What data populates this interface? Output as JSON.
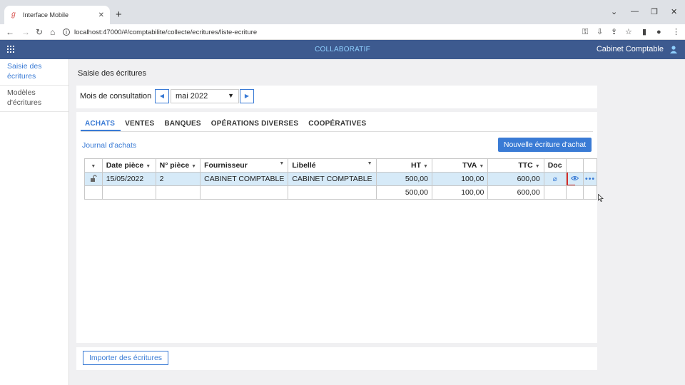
{
  "browser": {
    "tab_title": "Interface Mobile",
    "url": "localhost:47000/#/comptabilite/collecte/ecritures/liste-ecriture"
  },
  "app": {
    "title": "COLLABORATIF",
    "company": "Cabinet Comptable"
  },
  "sidebar": {
    "items": [
      {
        "label": "Saisie des écritures",
        "active": true
      },
      {
        "label": "Modèles d'écritures",
        "active": false
      }
    ]
  },
  "page": {
    "title": "Saisie des écritures"
  },
  "month": {
    "label": "Mois de consultation",
    "value": "mai 2022"
  },
  "tabs": [
    {
      "label": "ACHATS",
      "active": true
    },
    {
      "label": "VENTES",
      "active": false
    },
    {
      "label": "BANQUES",
      "active": false
    },
    {
      "label": "OPÉRATIONS DIVERSES",
      "active": false
    },
    {
      "label": "COOPÉRATIVES",
      "active": false
    }
  ],
  "journal": {
    "link": "Journal d'achats",
    "new_button": "Nouvelle écriture d'achat"
  },
  "table": {
    "headers": {
      "date": "Date pièce",
      "piece": "N° pièce",
      "fournisseur": "Fournisseur",
      "libelle": "Libellé",
      "ht": "HT",
      "tva": "TVA",
      "ttc": "TTC",
      "doc": "Doc"
    },
    "rows": [
      {
        "date": "15/05/2022",
        "piece": "2",
        "fournisseur": "CABINET COMPTABLE",
        "libelle": "CABINET COMPTABLE",
        "ht": "500,00",
        "tva": "100,00",
        "ttc": "600,00"
      }
    ],
    "totals": {
      "ht": "500,00",
      "tva": "100,00",
      "ttc": "600,00"
    }
  },
  "import_button": "Importer des écritures",
  "colors": {
    "appbar": "#3d5a8f",
    "accent": "#3a7bd5",
    "selected_row": "#d6eaf8"
  }
}
